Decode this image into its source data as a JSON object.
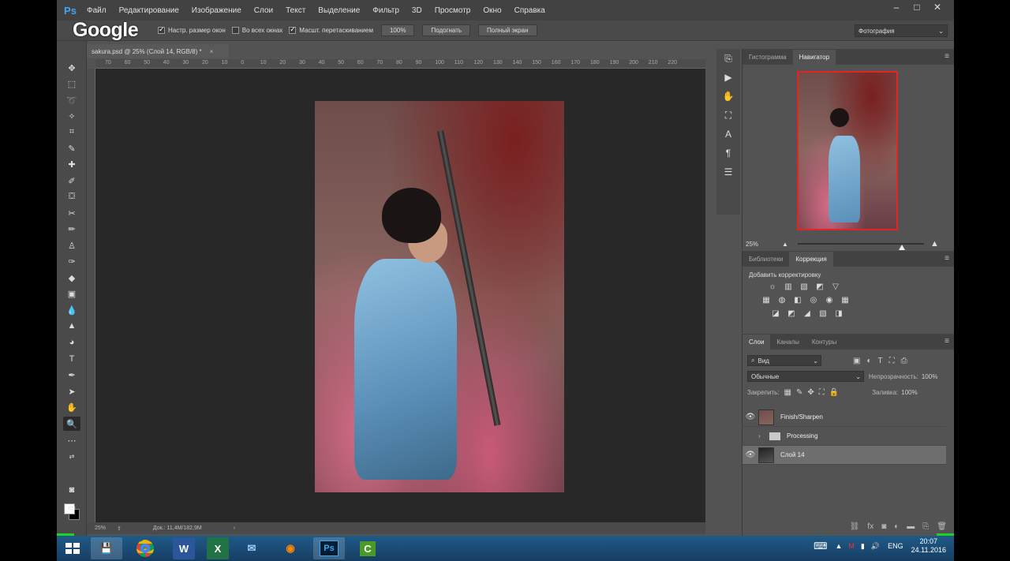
{
  "app": {
    "logo": "Ps",
    "watermark": "Google"
  },
  "menu": [
    "Файл",
    "Редактирование",
    "Изображение",
    "Слои",
    "Текст",
    "Выделение",
    "Фильтр",
    "3D",
    "Просмотр",
    "Окно",
    "Справка"
  ],
  "window_controls": [
    "–",
    "□",
    "✕"
  ],
  "options": {
    "resize_windows": "Настр. размер окон",
    "all_windows": "Во всех окнах",
    "scrubby_zoom": "Масшт. перетаскиванием",
    "zoom_100": "100%",
    "fit_screen": "Подогнать",
    "fill_screen": "Полный экран",
    "workspace": "Фотография"
  },
  "document": {
    "tab_title": "sakura.psd @ 25% (Слой 14, RGB/8) *",
    "status_zoom": "25%",
    "status_doc": "Док.: 11,4M/182,9M"
  },
  "ruler_ticks": [
    "70",
    "60",
    "50",
    "40",
    "30",
    "20",
    "10",
    "0",
    "10",
    "20",
    "30",
    "40",
    "50",
    "60",
    "70",
    "80",
    "90",
    "100",
    "110",
    "120",
    "130",
    "140",
    "150",
    "160",
    "170",
    "180",
    "190",
    "200",
    "210",
    "220"
  ],
  "navigator_panel": {
    "tabs": [
      "Гистограмма",
      "Навигатор"
    ],
    "zoom": "25%",
    "zoom_level": 0.25
  },
  "adjustments_panel": {
    "tabs": [
      "Библиотеки",
      "Коррекция"
    ],
    "title": "Добавить корректировку",
    "rows": [
      [
        "☼",
        "▥",
        "▧",
        "◩",
        "▽"
      ],
      [
        "▦",
        "◍",
        "◧",
        "◎",
        "◉",
        "▦"
      ],
      [
        "◪",
        "◩",
        "◢",
        "▧",
        "◨"
      ]
    ]
  },
  "layers_panel": {
    "tabs": [
      "Слои",
      "Каналы",
      "Контуры"
    ],
    "filter_label": "Вид",
    "blend_mode": "Обычные",
    "opacity_label": "Непрозрачность:",
    "opacity_value": "100%",
    "lock_label": "Закрепить:",
    "fill_label": "Заливка:",
    "fill_value": "100%",
    "layers": [
      {
        "name": "Finish/Sharpen",
        "visible": true,
        "type": "layer"
      },
      {
        "name": "Processing",
        "visible": false,
        "type": "group"
      },
      {
        "name": "Слой 14",
        "visible": true,
        "type": "layer",
        "selected": true
      }
    ]
  },
  "taskbar": {
    "apps": [
      "save",
      "chrome",
      "word",
      "excel",
      "mail",
      "firefox",
      "photoshop",
      "camtasia"
    ],
    "lang": "ENG",
    "time": "20:07",
    "date": "24.11.2016"
  }
}
